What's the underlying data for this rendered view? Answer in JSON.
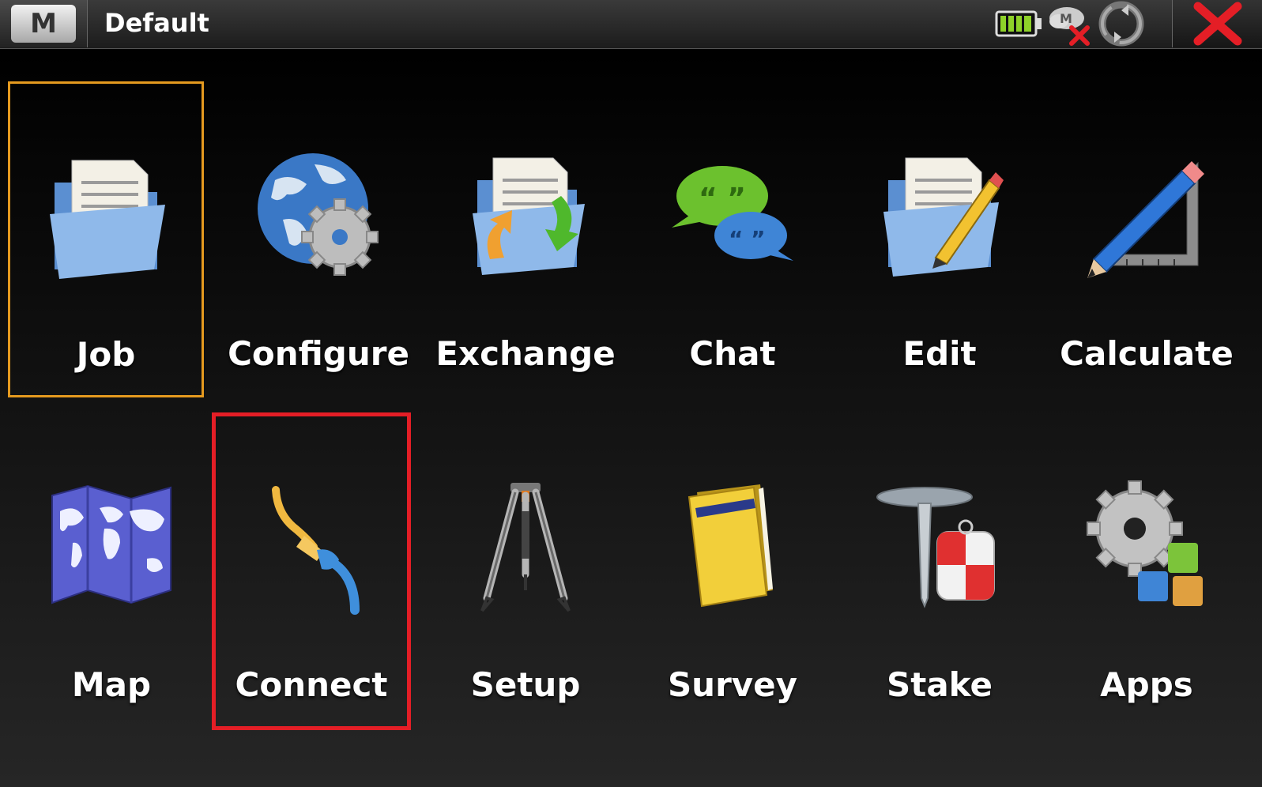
{
  "titlebar": {
    "menu_glyph": "M",
    "title": "Default",
    "status_icons": [
      "battery-icon",
      "cloud-disconnected-icon",
      "sync-icon"
    ],
    "close_icon": "close-icon"
  },
  "tiles": [
    {
      "label": "Job",
      "icon": "folder-document-icon",
      "state": "selected"
    },
    {
      "label": "Configure",
      "icon": "globe-gear-icon",
      "state": ""
    },
    {
      "label": "Exchange",
      "icon": "folder-exchange-icon",
      "state": ""
    },
    {
      "label": "Chat",
      "icon": "chat-bubbles-icon",
      "state": ""
    },
    {
      "label": "Edit",
      "icon": "folder-pencil-icon",
      "state": ""
    },
    {
      "label": "Calculate",
      "icon": "pencil-ruler-icon",
      "state": ""
    },
    {
      "label": "Map",
      "icon": "world-map-icon",
      "state": ""
    },
    {
      "label": "Connect",
      "icon": "cable-connector-icon",
      "state": "highlighted"
    },
    {
      "label": "Setup",
      "icon": "tripod-icon",
      "state": ""
    },
    {
      "label": "Survey",
      "icon": "field-book-icon",
      "state": ""
    },
    {
      "label": "Stake",
      "icon": "stake-target-icon",
      "state": ""
    },
    {
      "label": "Apps",
      "icon": "gear-blocks-icon",
      "state": ""
    }
  ],
  "colors": {
    "selected_border": "#e59a1f",
    "highlight_border": "#e41e26",
    "battery_fill": "#8ed129",
    "close_x": "#e41e26"
  }
}
